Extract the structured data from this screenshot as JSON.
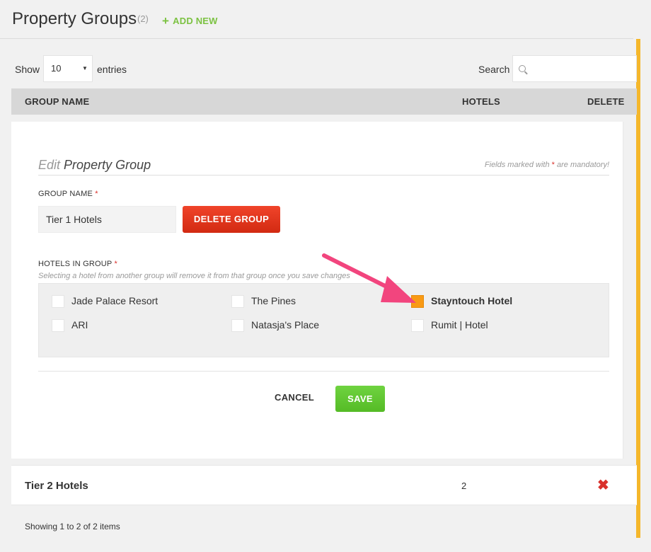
{
  "header": {
    "title": "Property Groups",
    "count": "(2)",
    "add_new_icon": "+",
    "add_new_label": "ADD NEW"
  },
  "controls": {
    "show_label": "Show",
    "entries_value": "10",
    "entries_label": "entries",
    "search_label": "Search",
    "search_value": ""
  },
  "table": {
    "columns": [
      "GROUP NAME",
      "HOTELS",
      "DELETE"
    ],
    "rows": [
      {
        "name": "Tier 2 Hotels",
        "hotels": "2",
        "delete_icon": "✖"
      }
    ],
    "info": "Showing 1 to 2 of 2 items"
  },
  "edit_form": {
    "heading_light": "Edit",
    "heading_main": "Property Group",
    "mandatory_prefix": "Fields marked with",
    "mandatory_star": "*",
    "mandatory_suffix": "are mandatory!",
    "group_name_label": "GROUP NAME",
    "group_name_value": "Tier 1 Hotels",
    "delete_group_label": "DELETE GROUP",
    "hotels_label": "HOTELS IN GROUP",
    "hotels_hint": "Selecting a hotel from another group will remove it from that group once you save changes",
    "hotels": [
      {
        "label": "Jade Palace Resort",
        "checked": false
      },
      {
        "label": "The Pines",
        "checked": false
      },
      {
        "label": "Stayntouch Hotel",
        "checked": true
      },
      {
        "label": "ARI",
        "checked": false
      },
      {
        "label": "Natasja's Place",
        "checked": false
      },
      {
        "label": "Rumit | Hotel",
        "checked": false
      }
    ],
    "cancel_label": "CANCEL",
    "save_label": "SAVE"
  },
  "colors": {
    "accent_green": "#7cc242",
    "delete_red": "#d9312b",
    "checked_orange": "#f99a14",
    "scroll_accent": "#f5b72b",
    "arrow_pink": "#f2457e"
  },
  "icons": [
    "plus-icon",
    "search-icon",
    "caret-down-icon",
    "delete-x-icon",
    "annotation-arrow-icon"
  ]
}
